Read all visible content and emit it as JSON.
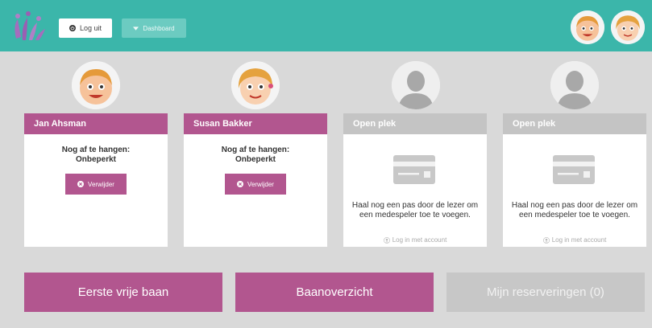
{
  "header": {
    "logout_label": "Log uit",
    "dashboard_label": "Dashboard",
    "accent_color": "#3bb6aa"
  },
  "players": [
    {
      "name": "Jan Ahsman",
      "status": "filled",
      "heading_line1": "Nog af te hangen:",
      "heading_line2": "Onbeperkt",
      "remove_label": "Verwijder"
    },
    {
      "name": "Susan Bakker",
      "status": "filled",
      "heading_line1": "Nog af te hangen:",
      "heading_line2": "Onbeperkt",
      "remove_label": "Verwijder"
    },
    {
      "name": "Open plek",
      "status": "open",
      "instruction": "Haal nog een pas door de lezer om een medespeler toe te voegen.",
      "login_label": "Log in met account"
    },
    {
      "name": "Open plek",
      "status": "open",
      "instruction": "Haal nog een pas door de lezer om een medespeler toe te voegen.",
      "login_label": "Log in met account"
    }
  ],
  "actions": {
    "first_free_court": "Eerste vrije baan",
    "court_overview": "Baanoverzicht",
    "my_reservations": "Mijn reserveringen (0)"
  },
  "colors": {
    "primary": "#b2568f",
    "disabled": "#c7c7c7",
    "background": "#d9d9d9"
  },
  "icons": [
    "logo-icon",
    "power-icon",
    "caret-down-icon",
    "remove-icon",
    "card-reader-icon",
    "user-icon",
    "person-silhouette-icon"
  ]
}
